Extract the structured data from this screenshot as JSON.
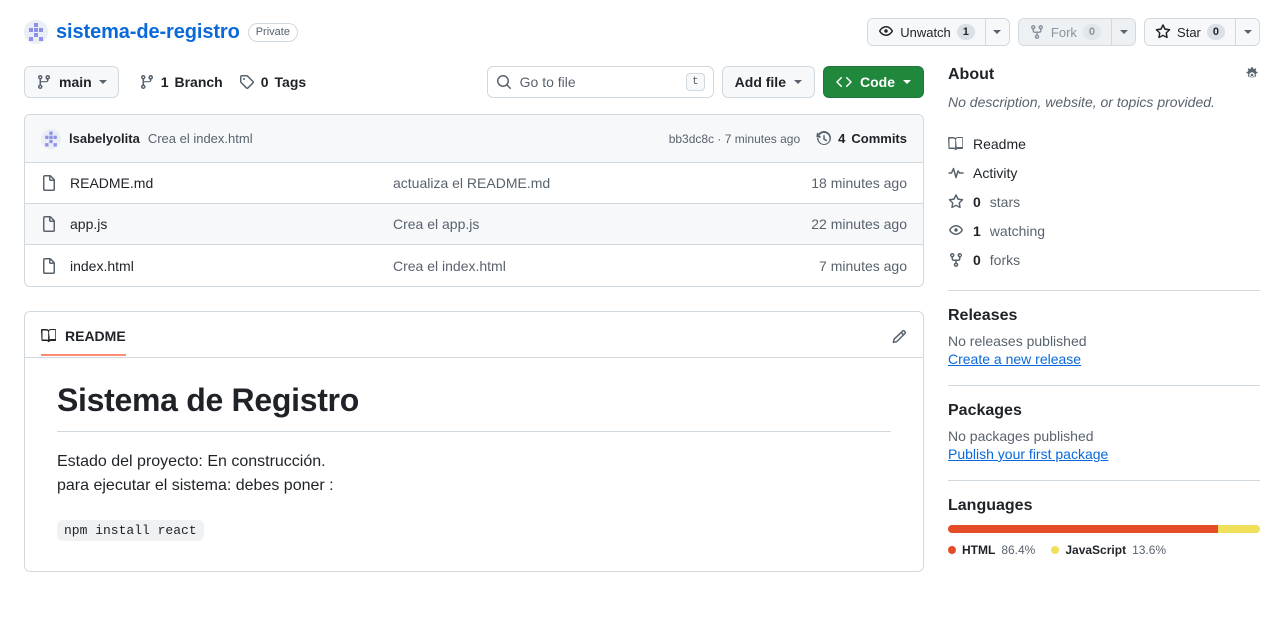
{
  "header": {
    "repo_name": "sistema-de-registro",
    "visibility": "Private",
    "avatar_icon": "repo-identicon",
    "actions": {
      "watch": {
        "icon": "eye-icon",
        "label": "Unwatch",
        "count": "1",
        "caret_icon": "chevron-down-icon"
      },
      "fork": {
        "icon": "fork-icon",
        "label": "Fork",
        "count": "0",
        "caret_icon": "chevron-down-icon",
        "disabled": true
      },
      "star": {
        "icon": "star-icon",
        "label": "Star",
        "count": "0",
        "caret_icon": "chevron-down-icon"
      }
    }
  },
  "toolbar": {
    "branch_icon": "branch-icon",
    "branch_name": "main",
    "branch_caret_icon": "chevron-down-icon",
    "branches": {
      "icon": "branch-icon",
      "count": "1",
      "label": "Branch"
    },
    "tags": {
      "icon": "tag-icon",
      "count": "0",
      "label": "Tags"
    },
    "go_to_file": {
      "icon": "search-icon",
      "placeholder": "Go to file",
      "shortcut": "t"
    },
    "add_file": {
      "label": "Add file",
      "caret_icon": "chevron-down-icon"
    },
    "code": {
      "icon": "code-brackets-icon",
      "label": "Code",
      "caret_icon": "chevron-down-icon",
      "color": "#1f883d"
    }
  },
  "commit_bar": {
    "avatar_icon": "user-identicon",
    "author": "lsabelyolita",
    "message": "Crea el index.html",
    "hash": "bb3dc8c",
    "separator": "·",
    "relative_time": "7 minutes ago",
    "history_icon": "history-icon",
    "commits_count": "4",
    "commits_label": "Commits"
  },
  "files": {
    "rows": [
      {
        "icon": "file-icon",
        "name": "README.md",
        "message": "actualiza el README.md",
        "time": "18 minutes ago"
      },
      {
        "icon": "file-icon",
        "name": "app.js",
        "message": "Crea el app.js",
        "time": "22 minutes ago"
      },
      {
        "icon": "file-icon",
        "name": "index.html",
        "message": "Crea el index.html",
        "time": "7 minutes ago"
      }
    ]
  },
  "readme": {
    "tab_icon": "book-icon",
    "tab_label": "README",
    "edit_icon": "pencil-icon",
    "accent_color": "#fd8c73",
    "heading": "Sistema de Registro",
    "paragraph_line1": "Estado del proyecto: En construcción.",
    "paragraph_line2": "para ejecutar el sistema: debes poner :",
    "code_snippet": "npm install react"
  },
  "sidebar": {
    "about": {
      "title": "About",
      "gear_icon": "gear-icon",
      "description": "No description, website, or topics provided.",
      "links": [
        {
          "icon": "book-icon",
          "label": "Readme"
        },
        {
          "icon": "activity-icon",
          "label": "Activity"
        }
      ],
      "stats": [
        {
          "icon": "star-icon",
          "count": "0",
          "label": "stars"
        },
        {
          "icon": "eye-icon",
          "count": "1",
          "label": "watching"
        },
        {
          "icon": "fork-icon",
          "count": "0",
          "label": "forks"
        }
      ]
    },
    "releases": {
      "title": "Releases",
      "empty_text": "No releases published",
      "action_link": "Create a new release"
    },
    "packages": {
      "title": "Packages",
      "empty_text": "No packages published",
      "action_link": "Publish your first package"
    },
    "languages": {
      "title": "Languages",
      "items": [
        {
          "name": "HTML",
          "percent": "86.4%",
          "color": "#e34c26",
          "width": "86.4%"
        },
        {
          "name": "JavaScript",
          "percent": "13.6%",
          "color": "#f1e05a",
          "width": "13.6%"
        }
      ]
    }
  }
}
